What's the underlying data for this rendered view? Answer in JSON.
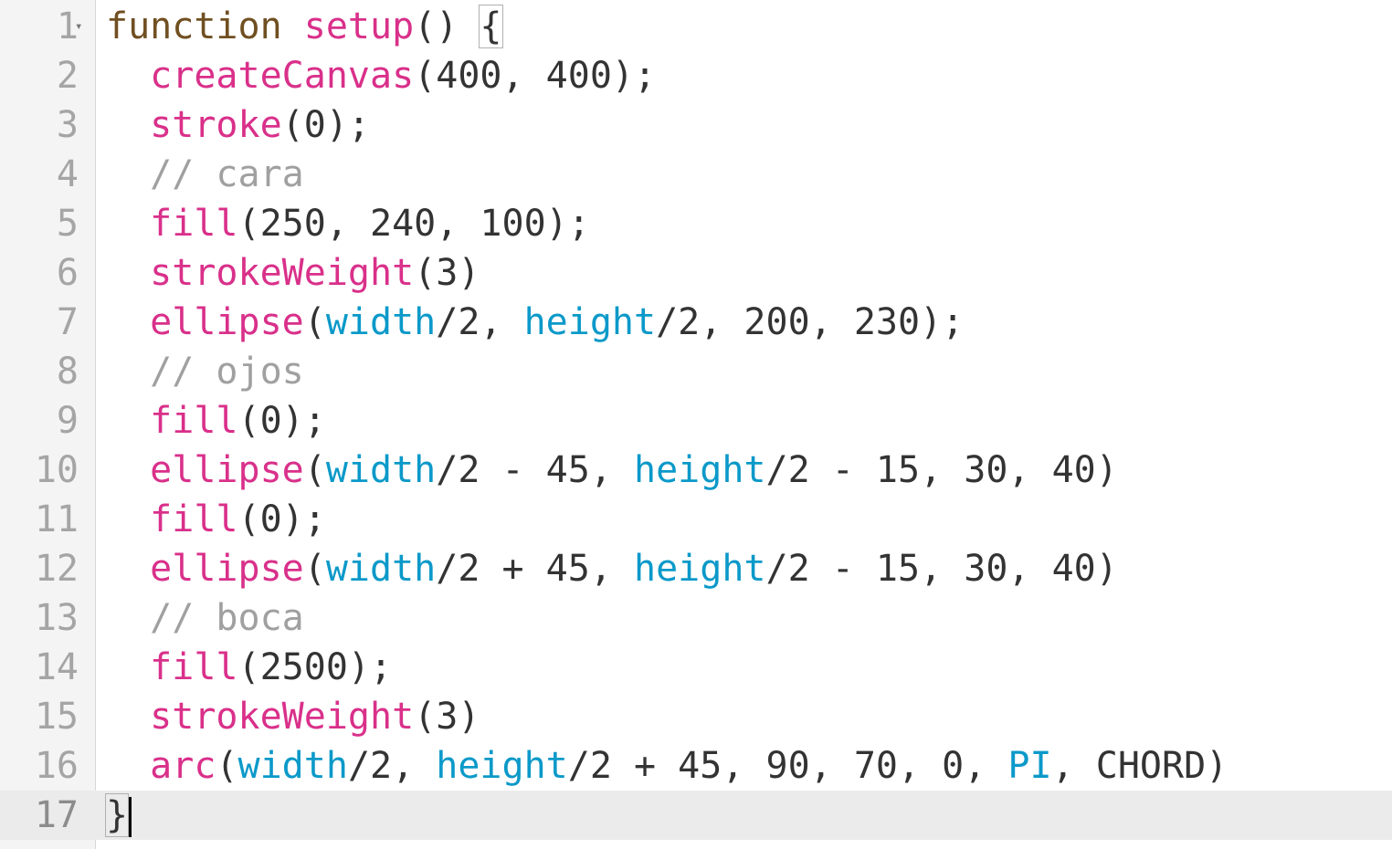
{
  "editor": {
    "active_line": 17,
    "fold_marker": "▾",
    "colors": {
      "keyword": "#704f21",
      "function": "#d9308a",
      "variable": "#0b99c9",
      "comment": "#a0a0a0",
      "text": "#333333"
    },
    "lines": [
      {
        "number": "1",
        "tokens": [
          {
            "t": "function",
            "c": "keyword"
          },
          {
            "t": " ",
            "c": "plain"
          },
          {
            "t": "setup",
            "c": "def"
          },
          {
            "t": "() ",
            "c": "plain"
          },
          {
            "t": "{",
            "c": "plain",
            "match": true
          }
        ]
      },
      {
        "number": "2",
        "tokens": [
          {
            "t": "  ",
            "c": "plain"
          },
          {
            "t": "createCanvas",
            "c": "builtin"
          },
          {
            "t": "(400, 400);",
            "c": "plain"
          }
        ]
      },
      {
        "number": "3",
        "tokens": [
          {
            "t": "  ",
            "c": "plain"
          },
          {
            "t": "stroke",
            "c": "builtin"
          },
          {
            "t": "(0);",
            "c": "plain"
          }
        ]
      },
      {
        "number": "4",
        "tokens": [
          {
            "t": "  ",
            "c": "plain"
          },
          {
            "t": "// cara",
            "c": "comment"
          }
        ]
      },
      {
        "number": "5",
        "tokens": [
          {
            "t": "  ",
            "c": "plain"
          },
          {
            "t": "fill",
            "c": "builtin"
          },
          {
            "t": "(250, 240, 100);",
            "c": "plain"
          }
        ]
      },
      {
        "number": "6",
        "tokens": [
          {
            "t": "  ",
            "c": "plain"
          },
          {
            "t": "strokeWeight",
            "c": "builtin"
          },
          {
            "t": "(3)",
            "c": "plain"
          }
        ]
      },
      {
        "number": "7",
        "tokens": [
          {
            "t": "  ",
            "c": "plain"
          },
          {
            "t": "ellipse",
            "c": "builtin"
          },
          {
            "t": "(",
            "c": "plain"
          },
          {
            "t": "width",
            "c": "variable"
          },
          {
            "t": "/2, ",
            "c": "plain"
          },
          {
            "t": "height",
            "c": "variable"
          },
          {
            "t": "/2, 200, 230);",
            "c": "plain"
          }
        ]
      },
      {
        "number": "8",
        "tokens": [
          {
            "t": "  ",
            "c": "plain"
          },
          {
            "t": "// ojos",
            "c": "comment"
          }
        ]
      },
      {
        "number": "9",
        "tokens": [
          {
            "t": "  ",
            "c": "plain"
          },
          {
            "t": "fill",
            "c": "builtin"
          },
          {
            "t": "(0);",
            "c": "plain"
          }
        ]
      },
      {
        "number": "10",
        "tokens": [
          {
            "t": "  ",
            "c": "plain"
          },
          {
            "t": "ellipse",
            "c": "builtin"
          },
          {
            "t": "(",
            "c": "plain"
          },
          {
            "t": "width",
            "c": "variable"
          },
          {
            "t": "/2 - 45, ",
            "c": "plain"
          },
          {
            "t": "height",
            "c": "variable"
          },
          {
            "t": "/2 - 15, 30, 40)",
            "c": "plain"
          }
        ]
      },
      {
        "number": "11",
        "tokens": [
          {
            "t": "  ",
            "c": "plain"
          },
          {
            "t": "fill",
            "c": "builtin"
          },
          {
            "t": "(0);",
            "c": "plain"
          }
        ]
      },
      {
        "number": "12",
        "tokens": [
          {
            "t": "  ",
            "c": "plain"
          },
          {
            "t": "ellipse",
            "c": "builtin"
          },
          {
            "t": "(",
            "c": "plain"
          },
          {
            "t": "width",
            "c": "variable"
          },
          {
            "t": "/2 + 45, ",
            "c": "plain"
          },
          {
            "t": "height",
            "c": "variable"
          },
          {
            "t": "/2 - 15, 30, 40)",
            "c": "plain"
          }
        ]
      },
      {
        "number": "13",
        "tokens": [
          {
            "t": "  ",
            "c": "plain"
          },
          {
            "t": "// boca",
            "c": "comment"
          }
        ]
      },
      {
        "number": "14",
        "tokens": [
          {
            "t": "  ",
            "c": "plain"
          },
          {
            "t": "fill",
            "c": "builtin"
          },
          {
            "t": "(2500);",
            "c": "plain"
          }
        ]
      },
      {
        "number": "15",
        "tokens": [
          {
            "t": "  ",
            "c": "plain"
          },
          {
            "t": "strokeWeight",
            "c": "builtin"
          },
          {
            "t": "(3)",
            "c": "plain"
          }
        ]
      },
      {
        "number": "16",
        "tokens": [
          {
            "t": "  ",
            "c": "plain"
          },
          {
            "t": "arc",
            "c": "builtin"
          },
          {
            "t": "(",
            "c": "plain"
          },
          {
            "t": "width",
            "c": "variable"
          },
          {
            "t": "/2, ",
            "c": "plain"
          },
          {
            "t": "height",
            "c": "variable"
          },
          {
            "t": "/2 + 45, 90, 70, 0, ",
            "c": "plain"
          },
          {
            "t": "PI",
            "c": "variable"
          },
          {
            "t": ", CHORD)",
            "c": "plain"
          }
        ]
      },
      {
        "number": "17",
        "tokens": [
          {
            "t": "}",
            "c": "plain",
            "match": true
          }
        ]
      }
    ]
  }
}
